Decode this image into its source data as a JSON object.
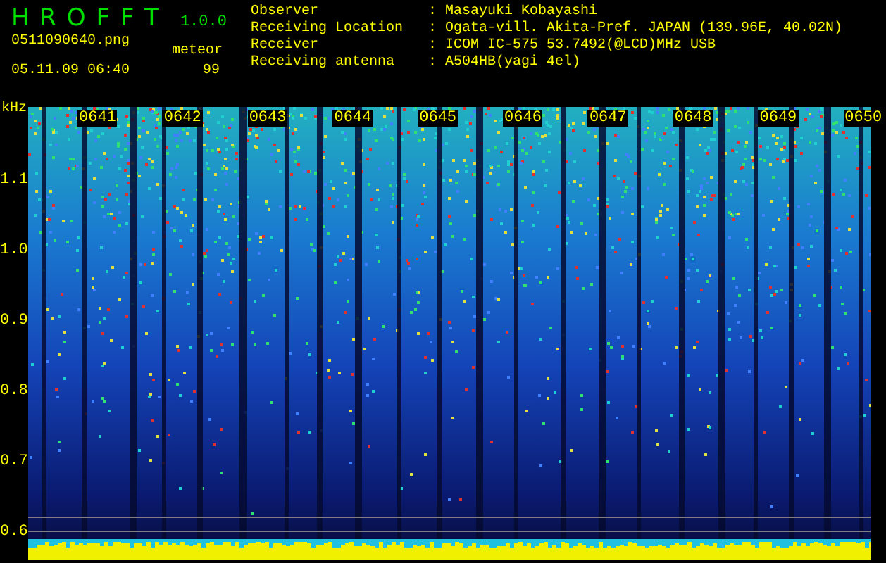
{
  "header": {
    "app_name": "H R O F F T",
    "version": "1.0.0",
    "filename": "0511090640.png",
    "datetime": "05.11.09 06:40",
    "count_label": "meteor",
    "count": "99"
  },
  "info": [
    {
      "label": "Observer",
      "separator": ":",
      "value": "Masayuki Kobayashi"
    },
    {
      "label": "Receiving Location",
      "separator": ":",
      "value": "Ogata-vill. Akita-Pref. JAPAN (139.96E, 40.02N)"
    },
    {
      "label": "Receiver",
      "separator": ":",
      "value": "ICOM IC-575 53.7492(@LCD)MHz USB"
    },
    {
      "label": "Receiving antenna",
      "separator": ":",
      "value": "A504HB(yagi 4el)"
    }
  ],
  "y_axis": {
    "unit": "kHz",
    "labels": [
      "1.1",
      "1.0",
      "0.9",
      "0.8",
      "0.7",
      "0.6"
    ]
  },
  "time_labels": [
    "0641",
    "0642",
    "0643",
    "0644",
    "0645",
    "0646",
    "0647",
    "0648",
    "0649",
    "0650"
  ]
}
